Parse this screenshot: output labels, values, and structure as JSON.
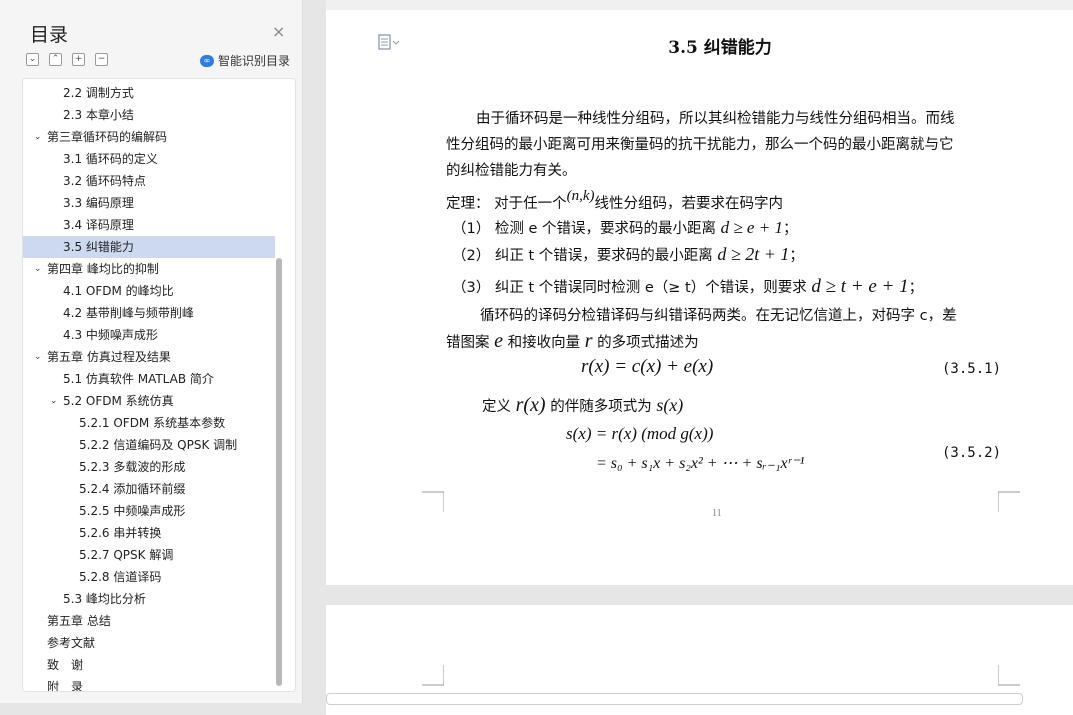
{
  "sidebar": {
    "title": "目录",
    "close_glyph": "×",
    "tools": [
      "⌄",
      "⌃",
      "+",
      "−"
    ],
    "ai_label": "智能识别目录",
    "ai_glyph": "∞",
    "toc": [
      {
        "label": "2.2 调制方式",
        "level": 2
      },
      {
        "label": "2.3 本章小结",
        "level": 2
      },
      {
        "label": "第三章循环码的编解码",
        "level": 1,
        "caret": "⌄"
      },
      {
        "label": "3.1 循环码的定义",
        "level": 2
      },
      {
        "label": "3.2 循环码特点",
        "level": 2
      },
      {
        "label": "3.3 编码原理",
        "level": 2
      },
      {
        "label": "3.4 译码原理",
        "level": 2
      },
      {
        "label": "3.5 纠错能力",
        "level": 2,
        "active": true
      },
      {
        "label": "第四章 峰均比的抑制",
        "level": 1,
        "caret": "⌄"
      },
      {
        "label": "4.1 OFDM 的峰均比",
        "level": 2
      },
      {
        "label": "4.2 基带削峰与频带削峰",
        "level": 2
      },
      {
        "label": "4.3 中频噪声成形",
        "level": 2
      },
      {
        "label": "第五章 仿真过程及结果",
        "level": 1,
        "caret": "⌄"
      },
      {
        "label": "5.1 仿真软件 MATLAB 简介",
        "level": 2
      },
      {
        "label": "5.2 OFDM 系统仿真",
        "level": 2,
        "caret": "⌄"
      },
      {
        "label": "5.2.1 OFDM 系统基本参数",
        "level": 3
      },
      {
        "label": "5.2.2 信道编码及 QPSK 调制",
        "level": 3
      },
      {
        "label": "5.2.3 多载波的形成",
        "level": 3
      },
      {
        "label": "5.2.4 添加循环前缀",
        "level": 3
      },
      {
        "label": "5.2.5 中频噪声成形",
        "level": 3
      },
      {
        "label": "5.2.6 串并转换",
        "level": 3
      },
      {
        "label": "5.2.7 QPSK 解调",
        "level": 3
      },
      {
        "label": "5.2.8 信道译码",
        "level": 3
      },
      {
        "label": "5.3 峰均比分析",
        "level": 2
      },
      {
        "label": "第五章 总结",
        "level": 0
      },
      {
        "label": "参考文献",
        "level": 0
      },
      {
        "label": "致　谢",
        "level": 0
      },
      {
        "label": "附　录",
        "level": 0
      }
    ]
  },
  "document": {
    "title": "3.5 纠错能力",
    "page_number": "11",
    "para1": [
      "由于循环码是一种线性分组码，所以其纠检错能力与线性分组码相当。而线",
      "性分组码的最小距离可用来衡量码的抗干扰能力，那么一个码的最小距离就与它",
      "的纠检错能力有关。"
    ],
    "theorem_pre": "定理：  对于任一个",
    "theorem_nk": "(n,k)",
    "theorem_post": "线性分组码，若要求在码字内",
    "item1_text": "（1） 检测 e 个错误，要求码的最小距离",
    "item1_math": "d  ≥  e + 1",
    "item1_end": "；",
    "item2_text": "（2） 纠正 t 个错误，要求码的最小距离",
    "item2_math": "d ≥ 2t + 1",
    "item2_end": "；",
    "item3_text": "（3） 纠正 t 个错误同时检测 e（≥ t）个错误，则要求",
    "item3_math": "d ≥ t + e + 1",
    "item3_end": "；",
    "para2_line1": "循环码的译码分检错译码与纠错译码两类。在无记忆信道上，对码字 c，差",
    "para2_pre": "错图案",
    "para2_e": "e",
    "para2_mid": "和接收向量",
    "para2_r": "r",
    "para2_post": "的多项式描述为",
    "eq1": "r(x) = c(x) + e(x)",
    "eq1_no": "(3.5.1)",
    "def_pre": "定义",
    "def_rx": "r(x)",
    "def_mid": "的伴随多项式为",
    "def_sx": "s(x)",
    "eq2_line1": "s(x) = r(x)   (mod   g(x))",
    "eq2_line2": "= s₀ + s₁x + s₂x² + ⋯ + sᵣ₋₁xʳ⁻¹",
    "eq2_no": "(3.5.2)"
  }
}
